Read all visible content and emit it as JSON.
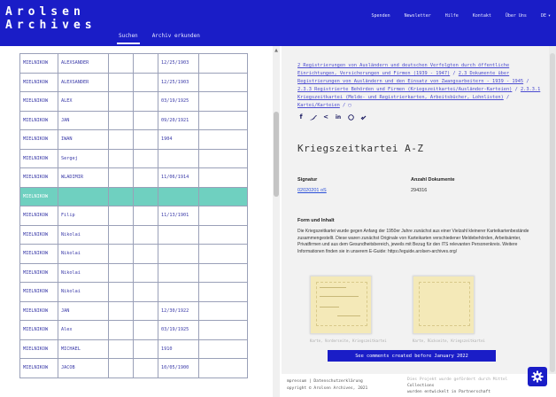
{
  "header": {
    "logo_line1": "Arolsen",
    "logo_line2": "Archives",
    "tabs": [
      {
        "label": "Suchen",
        "active": true
      },
      {
        "label": "Archiv erkunden",
        "active": false
      }
    ],
    "nav": [
      "Spenden",
      "Newsletter",
      "Hilfe",
      "Kontakt",
      "Über Uns"
    ],
    "language": "DE"
  },
  "results_table": {
    "rows": [
      {
        "c1": "MIELNIKOW",
        "c2": "ALEXSANDER",
        "c3": "",
        "c4": "",
        "c5": "12/25/1903",
        "c6": ""
      },
      {
        "c1": "MIELNIKOW",
        "c2": "ALEXSANDER",
        "c3": "",
        "c4": "",
        "c5": "12/25/1903",
        "c6": ""
      },
      {
        "c1": "MIELNIKOW",
        "c2": "ALEX",
        "c3": "",
        "c4": "",
        "c5": "03/19/1925",
        "c6": ""
      },
      {
        "c1": "MIELNIKOW",
        "c2": "JAN",
        "c3": "",
        "c4": "",
        "c5": "09/20/1921",
        "c6": ""
      },
      {
        "c1": "MIELNIKOW",
        "c2": "IWAN",
        "c3": "",
        "c4": "",
        "c5": "1904",
        "c6": ""
      },
      {
        "c1": "MIELNIKOW",
        "c2": "Sergej",
        "c3": "",
        "c4": "",
        "c5": "",
        "c6": ""
      },
      {
        "c1": "MIELNIKOW",
        "c2": "WLADIMIR",
        "c3": "",
        "c4": "",
        "c5": "11/06/1914",
        "c6": ""
      },
      {
        "c1": "MIELNIKOW",
        "c2": "",
        "c3": "",
        "c4": "",
        "c5": "",
        "c6": "",
        "highlight": true
      },
      {
        "c1": "MIELNIKOW",
        "c2": "Filip",
        "c3": "",
        "c4": "",
        "c5": "11/13/1901",
        "c6": ""
      },
      {
        "c1": "MIELNIKOW",
        "c2": "Nikolai",
        "c3": "",
        "c4": "",
        "c5": "",
        "c6": ""
      },
      {
        "c1": "MIELNIKOW",
        "c2": "Nikolai",
        "c3": "",
        "c4": "",
        "c5": "",
        "c6": ""
      },
      {
        "c1": "MIELNIKOW",
        "c2": "Nikolai",
        "c3": "",
        "c4": "",
        "c5": "",
        "c6": ""
      },
      {
        "c1": "MIELNIKOW",
        "c2": "Nikolai",
        "c3": "",
        "c4": "",
        "c5": "",
        "c6": ""
      },
      {
        "c1": "MIELNIKOW",
        "c2": "JAN",
        "c3": "",
        "c4": "",
        "c5": "12/30/1922",
        "c6": ""
      },
      {
        "c1": "MIELNIKOW",
        "c2": "Alex",
        "c3": "",
        "c4": "",
        "c5": "03/19/1925",
        "c6": ""
      },
      {
        "c1": "MIELNIKOW",
        "c2": "MICHAEL",
        "c3": "",
        "c4": "",
        "c5": "1910",
        "c6": ""
      },
      {
        "c1": "MIELNIKOW",
        "c2": "JACOB",
        "c3": "",
        "c4": "",
        "c5": "10/05/1900",
        "c6": ""
      }
    ]
  },
  "detail": {
    "breadcrumb": [
      "2 Registrierungen von Ausländern und deutschen Verfolgten durch öffentliche Einrichtungen, Versicherungen und Firmen (1939 - 1947)",
      "2.3 Dokumente über Registrierungen von Ausländern und den Einsatz von Zwangsarbeitern - 1939 - 1945",
      "2.3.3 Registrierte Behörden und Firmen (Kriegszeitkartei/Ausländer-Karteien)",
      "2.3.3.1 Kriegszeitkartei (Melde- und Registrierkarten, Arbeitsbücher, Lohnlisten)",
      "Kartei/Karteien"
    ],
    "share_icons": [
      "facebook-icon",
      "twitter-icon",
      "share-icon",
      "linkedin-icon",
      "whatsapp-icon",
      "link-icon"
    ],
    "title": "Kriegszeitkartei A-Z",
    "signature_label": "Signatur",
    "signature_value": "02020201 oS",
    "count_label": "Anzahl Dokumente",
    "count_value": "294316",
    "form_heading": "Form und Inhalt",
    "form_text": "Die Kriegszeitkartei wurde gegen Anfang der 1950er Jahre zunächst aus einer Vielzahl kleinerer Karteikartenbestände zusammengestellt. Diese waren zunächst Originale von Karteikarten verschiedener Meldebehörden, Arbeitsämter, Privatfirmen und aus dem Gesundheitsbereich, jeweils mit Bezug für den ITS relevanten Personenkreis. Weitere Informationen finden sie in unserem E-Guide: https://eguide.arolsen-archives.org/",
    "thumb_caption_a": "Karte, Vorderseite, Kriegszeitkartei",
    "thumb_caption_b": "Karte, Rückseite, Kriegszeitkartei",
    "comments_button": "See comments created before January 2022"
  },
  "footer": {
    "left_line1": "mpressum  |  Datenschutzerklärung",
    "left_line2": "opyright © Arolsen Archives, 2021",
    "right_line1": "Dies Projekt wurde gefördert durch Mittel",
    "right_line2": "Collections",
    "right_line3": "wurden entwickelt in Partnerschaft"
  },
  "colors": {
    "brand_blue": "#1a1dc7",
    "highlight_row": "#6fd0c0",
    "link": "#4a4ad0"
  }
}
